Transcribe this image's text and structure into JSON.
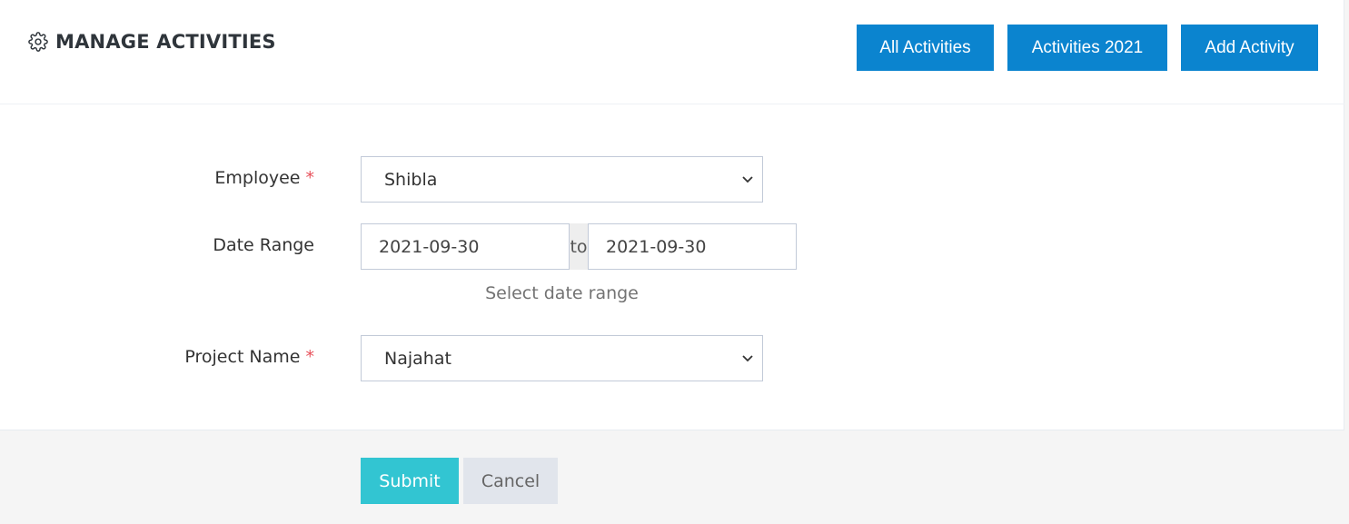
{
  "header": {
    "title": "MANAGE ACTIVITIES",
    "title_icon": "gear-icon",
    "buttons": [
      {
        "label": "All Activities"
      },
      {
        "label": "Activities 2021"
      },
      {
        "label": "Add Activity"
      }
    ]
  },
  "form": {
    "employee": {
      "label": "Employee",
      "required_mark": "*",
      "value": "Shibla"
    },
    "date_range": {
      "label": "Date Range",
      "from": "2021-09-30",
      "separator": "to",
      "to": "2021-09-30",
      "help": "Select date range"
    },
    "project": {
      "label": "Project Name",
      "required_mark": "*",
      "value": "Najahat"
    }
  },
  "actions": {
    "submit": "Submit",
    "cancel": "Cancel"
  },
  "colors": {
    "primary_blue": "#0b84cf",
    "submit_teal": "#32c5d2",
    "cancel_gray": "#e1e5ec",
    "required_red": "#e7505a"
  }
}
